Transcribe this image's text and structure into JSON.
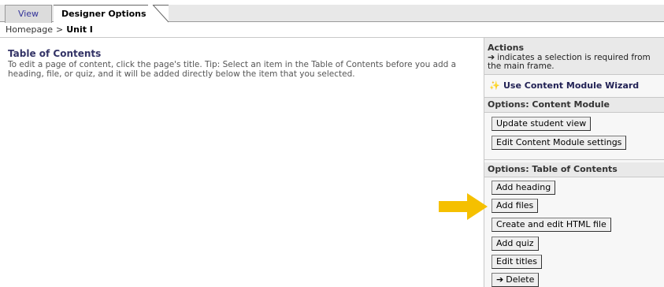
{
  "tabs": [
    {
      "label": "View",
      "active": false
    },
    {
      "label": "Designer Options",
      "active": true
    }
  ],
  "breadcrumb": {
    "home": "Homepage",
    "separator": ">",
    "current": "Unit I"
  },
  "main": {
    "title": "Table of Contents",
    "description": "To edit a page of content, click the page's title. Tip: Select an item in the Table of Contents before you add a heading, file, or quiz, and it will be added directly below the item that you selected."
  },
  "sidebar": {
    "actions": {
      "heading": "Actions",
      "note_icon": "arrow-right-icon",
      "note": "indicates a selection is required from the main frame."
    },
    "wizard": {
      "icon": "wand-icon",
      "label": "Use Content Module Wizard"
    },
    "content_module": {
      "heading": "Options: Content Module",
      "buttons": [
        "Update student view",
        "Edit Content Module settings"
      ]
    },
    "table_of_contents": {
      "heading": "Options: Table of Contents",
      "buttons": [
        "Add heading",
        "Add files",
        "Create and edit HTML file",
        "Add quiz",
        "Edit titles",
        "Delete"
      ]
    }
  },
  "colors": {
    "pointer_arrow": "#f5c000",
    "title_blue": "#333366",
    "sidebar_header_bg": "#e9e9e9"
  }
}
